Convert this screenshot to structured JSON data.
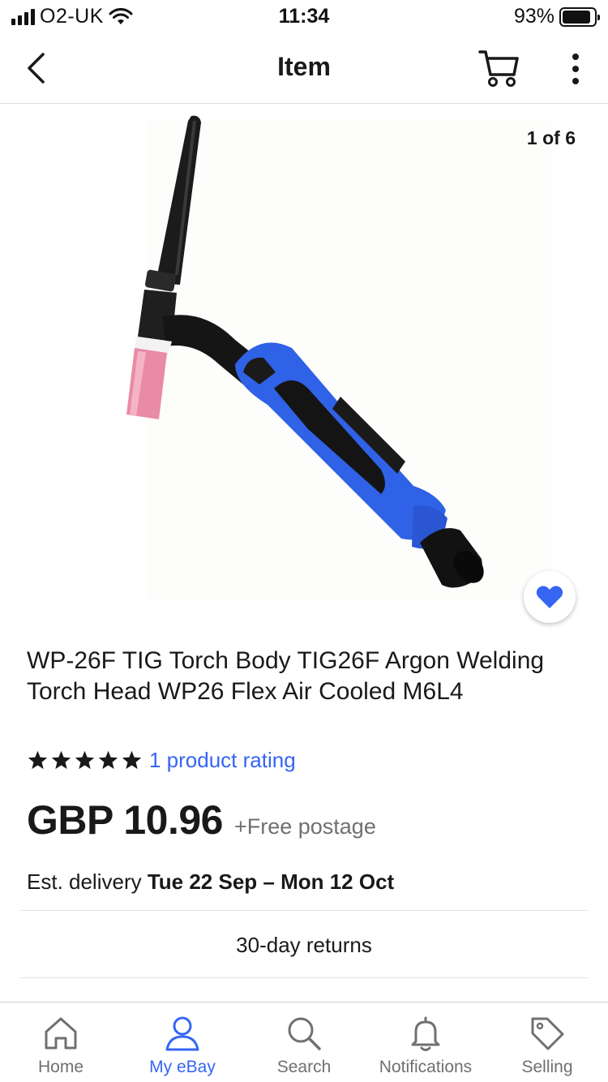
{
  "status_bar": {
    "carrier": "O2-UK",
    "time": "11:34",
    "battery": "93%"
  },
  "nav": {
    "title": "Item"
  },
  "gallery": {
    "counter": "1 of 6"
  },
  "item": {
    "title": "WP-26F TIG Torch Body TIG26F Argon Welding Torch Head WP26 Flex Air Cooled M6L4",
    "rating_stars": 5,
    "rating_text": "1 product rating",
    "price": "GBP 10.96",
    "postage": "+Free postage",
    "delivery_prefix": "Est. delivery",
    "delivery_dates": "Tue 22 Sep – Mon 12 Oct",
    "returns": "30-day returns"
  },
  "tabbar": {
    "tabs": [
      {
        "label": "Home",
        "icon": "home-icon"
      },
      {
        "label": "My eBay",
        "icon": "person-icon"
      },
      {
        "label": "Search",
        "icon": "search-icon"
      },
      {
        "label": "Notifications",
        "icon": "bell-icon"
      },
      {
        "label": "Selling",
        "icon": "tag-icon"
      }
    ],
    "active": "My eBay"
  },
  "colors": {
    "accent": "#3665f3",
    "text": "#191919",
    "secondary": "#707070"
  }
}
